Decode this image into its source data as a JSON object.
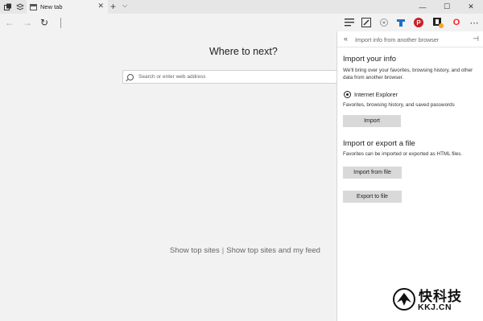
{
  "tab": {
    "title": "New tab",
    "close": "✕"
  },
  "newtab_glyph": "+",
  "tabmenu_glyph": "⌵",
  "window": {
    "minimize": "—",
    "maximize": "☐",
    "close": "✕"
  },
  "nav": {
    "back": "←",
    "forward": "→",
    "refresh": "↻"
  },
  "toolbar_icons": [
    "hub-icon",
    "web-note-icon",
    "share-icon",
    "extension-icon",
    "pinterest-icon",
    "evernote-icon",
    "opera-icon",
    "more-icon"
  ],
  "toolbar": {
    "more": "⋯",
    "pinterest": "P",
    "opera": "O"
  },
  "main": {
    "headline": "Where to next?",
    "search_placeholder": "Search or enter web address",
    "show_top_sites": "Show top sites",
    "separator": "|",
    "show_top_sites_feed": "Show top sites and my feed"
  },
  "panel": {
    "back": "«",
    "title": "Import info from another browser",
    "pin": "⊣",
    "import_title": "Import your info",
    "import_desc": "We'll bring over your favorites, browsing history, and other data from another browser.",
    "browser_option": "Internet Explorer",
    "browser_desc": "Favorites, browsing history, and saved passwords",
    "import_button": "Import",
    "file_title": "Import or export a file",
    "file_desc": "Favorites can be imported or exported as HTML files.",
    "import_file_button": "Import from file",
    "export_file_button": "Export to file"
  },
  "watermark": {
    "cn": "快科技",
    "url": "KKJ.CN"
  },
  "colors": {
    "panel_bg": "#ffffff",
    "button_bg": "#d9d9d9",
    "page_bg": "#f2f2f2",
    "pinterest": "#cb2027",
    "opera": "#ff1b2d",
    "extension": "#1e6fc9",
    "badge": "#f5a623"
  }
}
